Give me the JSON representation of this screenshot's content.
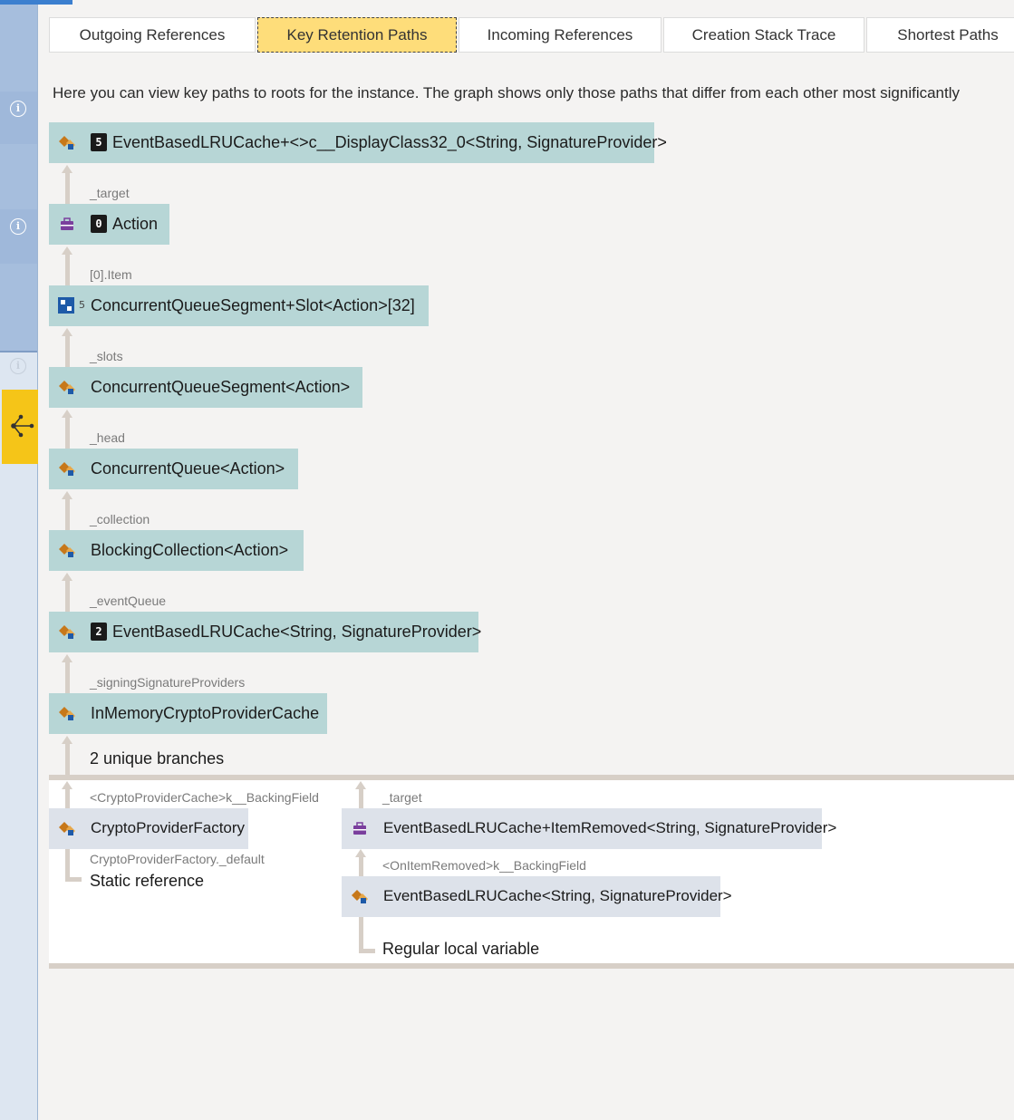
{
  "tabs": [
    {
      "label": "Outgoing References",
      "selected": false
    },
    {
      "label": "Key Retention Paths",
      "selected": true
    },
    {
      "label": "Incoming References",
      "selected": false
    },
    {
      "label": "Creation Stack Trace",
      "selected": false
    },
    {
      "label": "Shortest Paths",
      "selected": false
    }
  ],
  "description": "Here you can view key paths to roots for the instance. The graph shows only those paths that differ from each other most significantly",
  "path_nodes": [
    {
      "label": "EventBasedLRUCache+<>c__DisplayClass32_0<String, SignatureProvider>",
      "icon": "class-icon",
      "pin": "5",
      "edge_label": "_target"
    },
    {
      "label": "Action",
      "icon": "delegate-icon",
      "pin": "0",
      "edge_label": "[0].Item"
    },
    {
      "label": "ConcurrentQueueSegment+Slot<Action>[32]",
      "icon": "array-icon",
      "pin": "",
      "edge_label": "_slots"
    },
    {
      "label": "ConcurrentQueueSegment<Action>",
      "icon": "class-icon",
      "pin": "",
      "edge_label": "_head"
    },
    {
      "label": "ConcurrentQueue<Action>",
      "icon": "class-icon",
      "pin": "",
      "edge_label": "_collection"
    },
    {
      "label": "BlockingCollection<Action>",
      "icon": "class-icon",
      "pin": "",
      "edge_label": "_eventQueue"
    },
    {
      "label": "EventBasedLRUCache<String, SignatureProvider>",
      "icon": "class-icon",
      "pin": "2",
      "edge_label": "_signingSignatureProviders"
    },
    {
      "label": "InMemoryCryptoProviderCache",
      "icon": "class-icon",
      "pin": "",
      "edge_label": ""
    }
  ],
  "array_hint": "5",
  "branches_label": "2 unique branches",
  "branch_left": {
    "edge_top": "<CryptoProviderCache>k__BackingField",
    "node": "CryptoProviderFactory",
    "edge_bottom": "CryptoProviderFactory._default",
    "root": "Static reference"
  },
  "branch_right": {
    "edge_top": "_target",
    "node1": "EventBasedLRUCache+ItemRemoved<String, SignatureProvider>",
    "edge_mid": "<OnItemRemoved>k__BackingField",
    "node2": "EventBasedLRUCache<String, SignatureProvider>",
    "root": "Regular local variable"
  },
  "colors": {
    "node_bg": "#b7d6d6",
    "branch_node_bg": "#dde2ea",
    "selected_tab": "#fedd7a",
    "rail_active": "#f5c518",
    "connector": "#d7cfc7"
  }
}
